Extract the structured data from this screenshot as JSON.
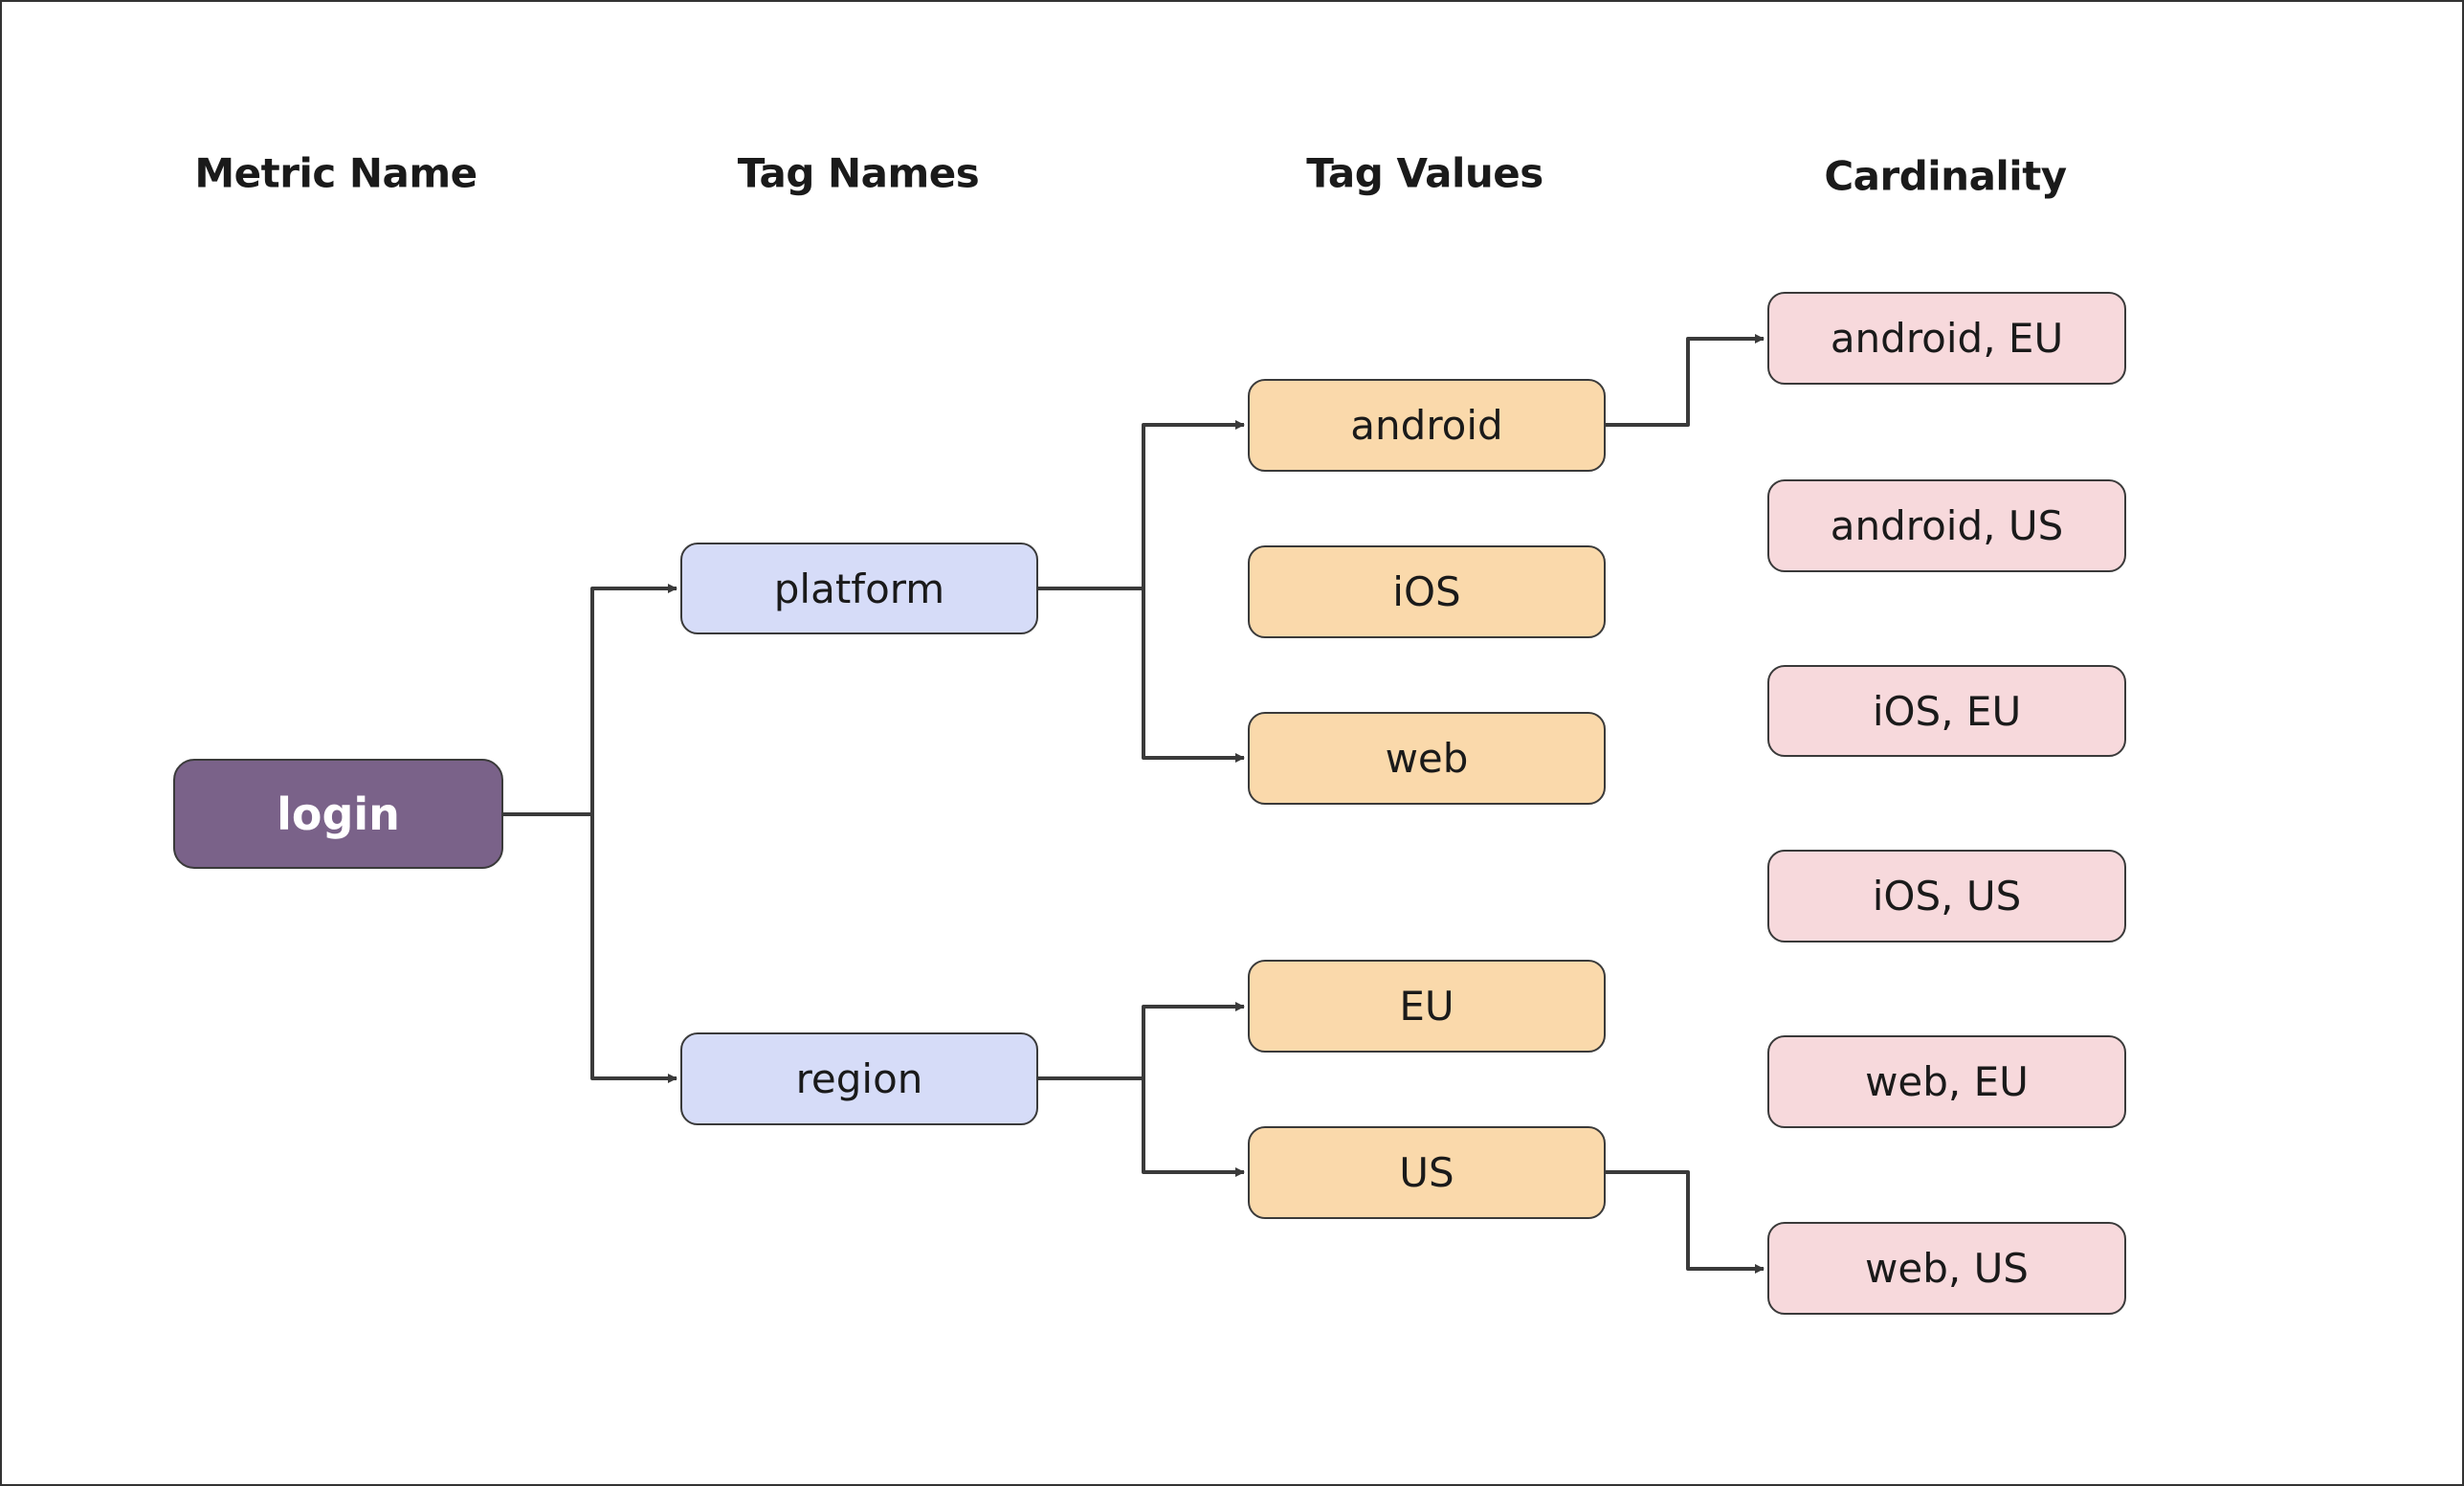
{
  "headers": {
    "metric_name": "Metric Name",
    "tag_names": "Tag Names",
    "tag_values": "Tag Values",
    "cardinality": "Cardinality"
  },
  "metric": {
    "label": "login"
  },
  "tag_names": [
    {
      "label": "platform"
    },
    {
      "label": "region"
    }
  ],
  "tag_values": [
    {
      "label": "android",
      "tag": "platform"
    },
    {
      "label": "iOS",
      "tag": "platform"
    },
    {
      "label": "web",
      "tag": "platform"
    },
    {
      "label": "EU",
      "tag": "region"
    },
    {
      "label": "US",
      "tag": "region"
    }
  ],
  "cardinality": [
    {
      "label": "android, EU"
    },
    {
      "label": "android, US"
    },
    {
      "label": "iOS, EU"
    },
    {
      "label": "iOS, US"
    },
    {
      "label": "web, EU"
    },
    {
      "label": "web, US"
    }
  ],
  "edges": [
    {
      "from": "login",
      "to": "platform"
    },
    {
      "from": "login",
      "to": "region"
    },
    {
      "from": "platform",
      "to": "android"
    },
    {
      "from": "platform",
      "to": "web"
    },
    {
      "from": "region",
      "to": "EU"
    },
    {
      "from": "region",
      "to": "US"
    },
    {
      "from": "android",
      "to": "android, EU"
    },
    {
      "from": "US",
      "to": "web, US"
    }
  ],
  "colors": {
    "metric_fill": "#7a6289",
    "tag_name_fill": "#d6dcf8",
    "tag_value_fill": "#fad9ab",
    "cardinality_fill": "#f7d9dc",
    "stroke": "#3a3a3a"
  }
}
